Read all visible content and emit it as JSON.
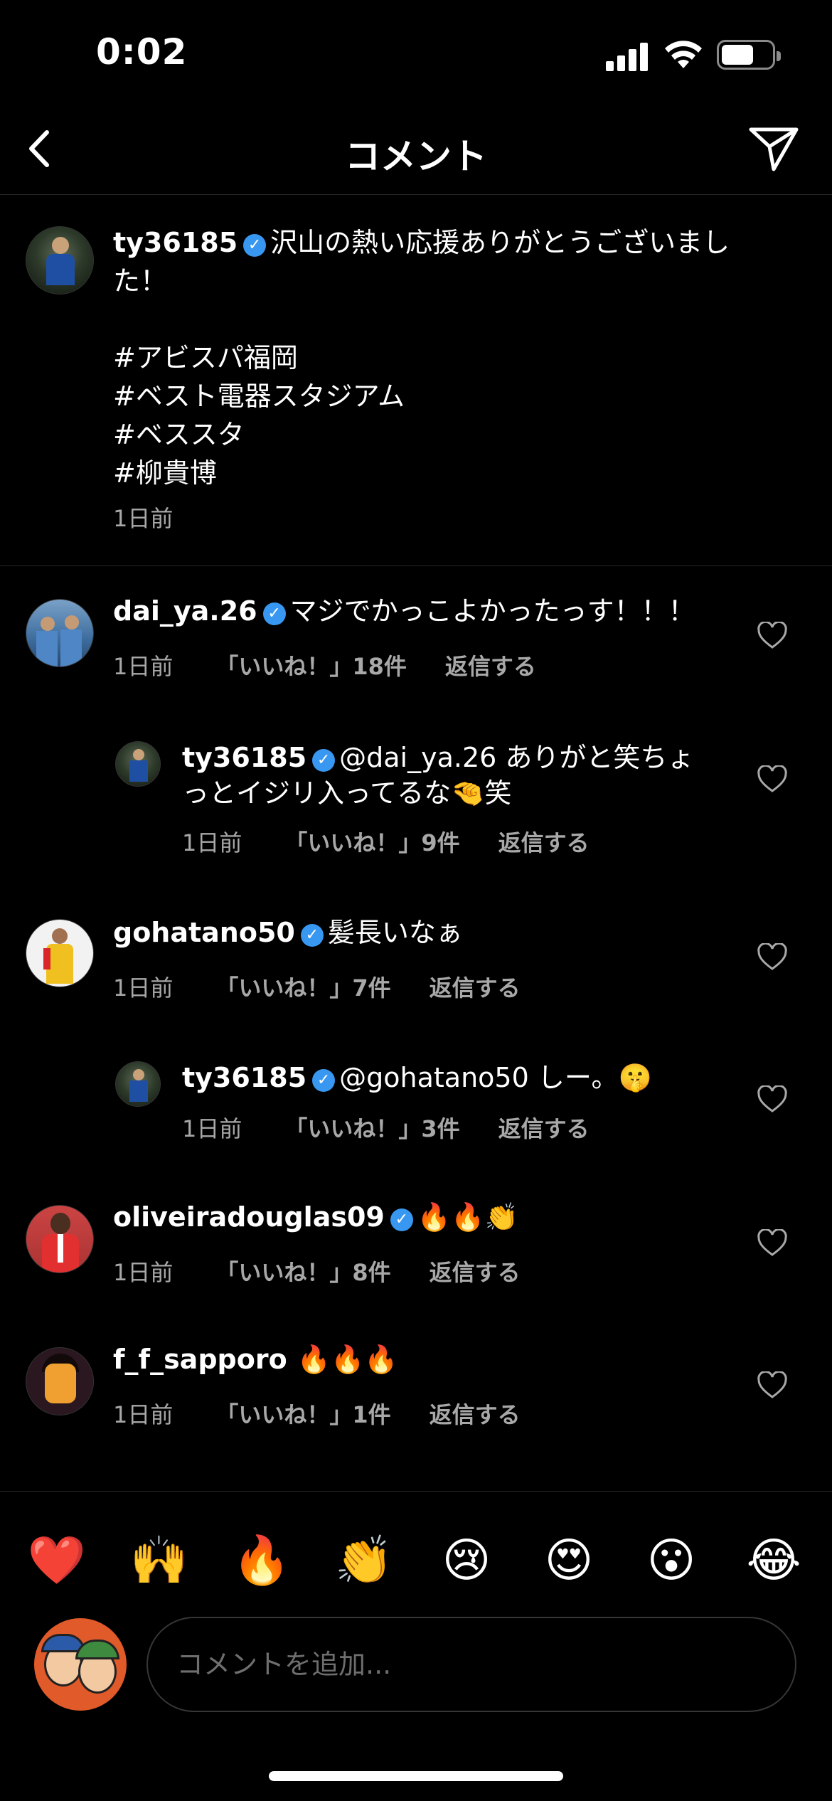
{
  "status": {
    "time": "0:02",
    "battery_level": 0.65
  },
  "header": {
    "title": "コメント"
  },
  "caption": {
    "username": "ty36185",
    "lines": [
      "沢山の熱い応援ありがとうございまし",
      "た！",
      "",
      "#アビスパ福岡",
      "#ベスト電器スタジアム",
      "#ベススタ",
      "#柳貴博"
    ],
    "time": "1日前"
  },
  "comments": [
    {
      "username": "dai_ya.26",
      "text": "マジでかっこよかったっす！！！",
      "time": "1日前",
      "likes": "「いいね！」18件",
      "reply": "返信する"
    },
    {
      "username": "ty36185",
      "text_line1": "@dai_ya.26 ありがと笑ちょ",
      "text_line2": "っとイジリ入ってるな🤏笑",
      "time": "1日前",
      "likes": "「いいね！」9件",
      "reply": "返信する"
    },
    {
      "username": "gohatano50",
      "text": "髪長いなぁ",
      "time": "1日前",
      "likes": "「いいね！」7件",
      "reply": "返信する"
    },
    {
      "username": "ty36185",
      "text": "@gohatano50 しー。🤫",
      "time": "1日前",
      "likes": "「いいね！」3件",
      "reply": "返信する"
    },
    {
      "username": "oliveiradouglas09",
      "text": "🔥🔥👏",
      "time": "1日前",
      "likes": "「いいね！」8件",
      "reply": "返信する"
    },
    {
      "username": "f_f_sapporo",
      "text": "🔥🔥🔥",
      "time": "1日前",
      "likes": "「いいね！」1件",
      "reply": "返信する"
    }
  ],
  "emoji_bar": [
    "❤️",
    "🙌",
    "🔥",
    "👏",
    "😢",
    "😍",
    "😮",
    "😂"
  ],
  "composer": {
    "placeholder": "コメントを追加..."
  },
  "colors": {
    "background": "#000000",
    "verified": "#3897f0",
    "secondary_text": "#a8a8a8"
  }
}
